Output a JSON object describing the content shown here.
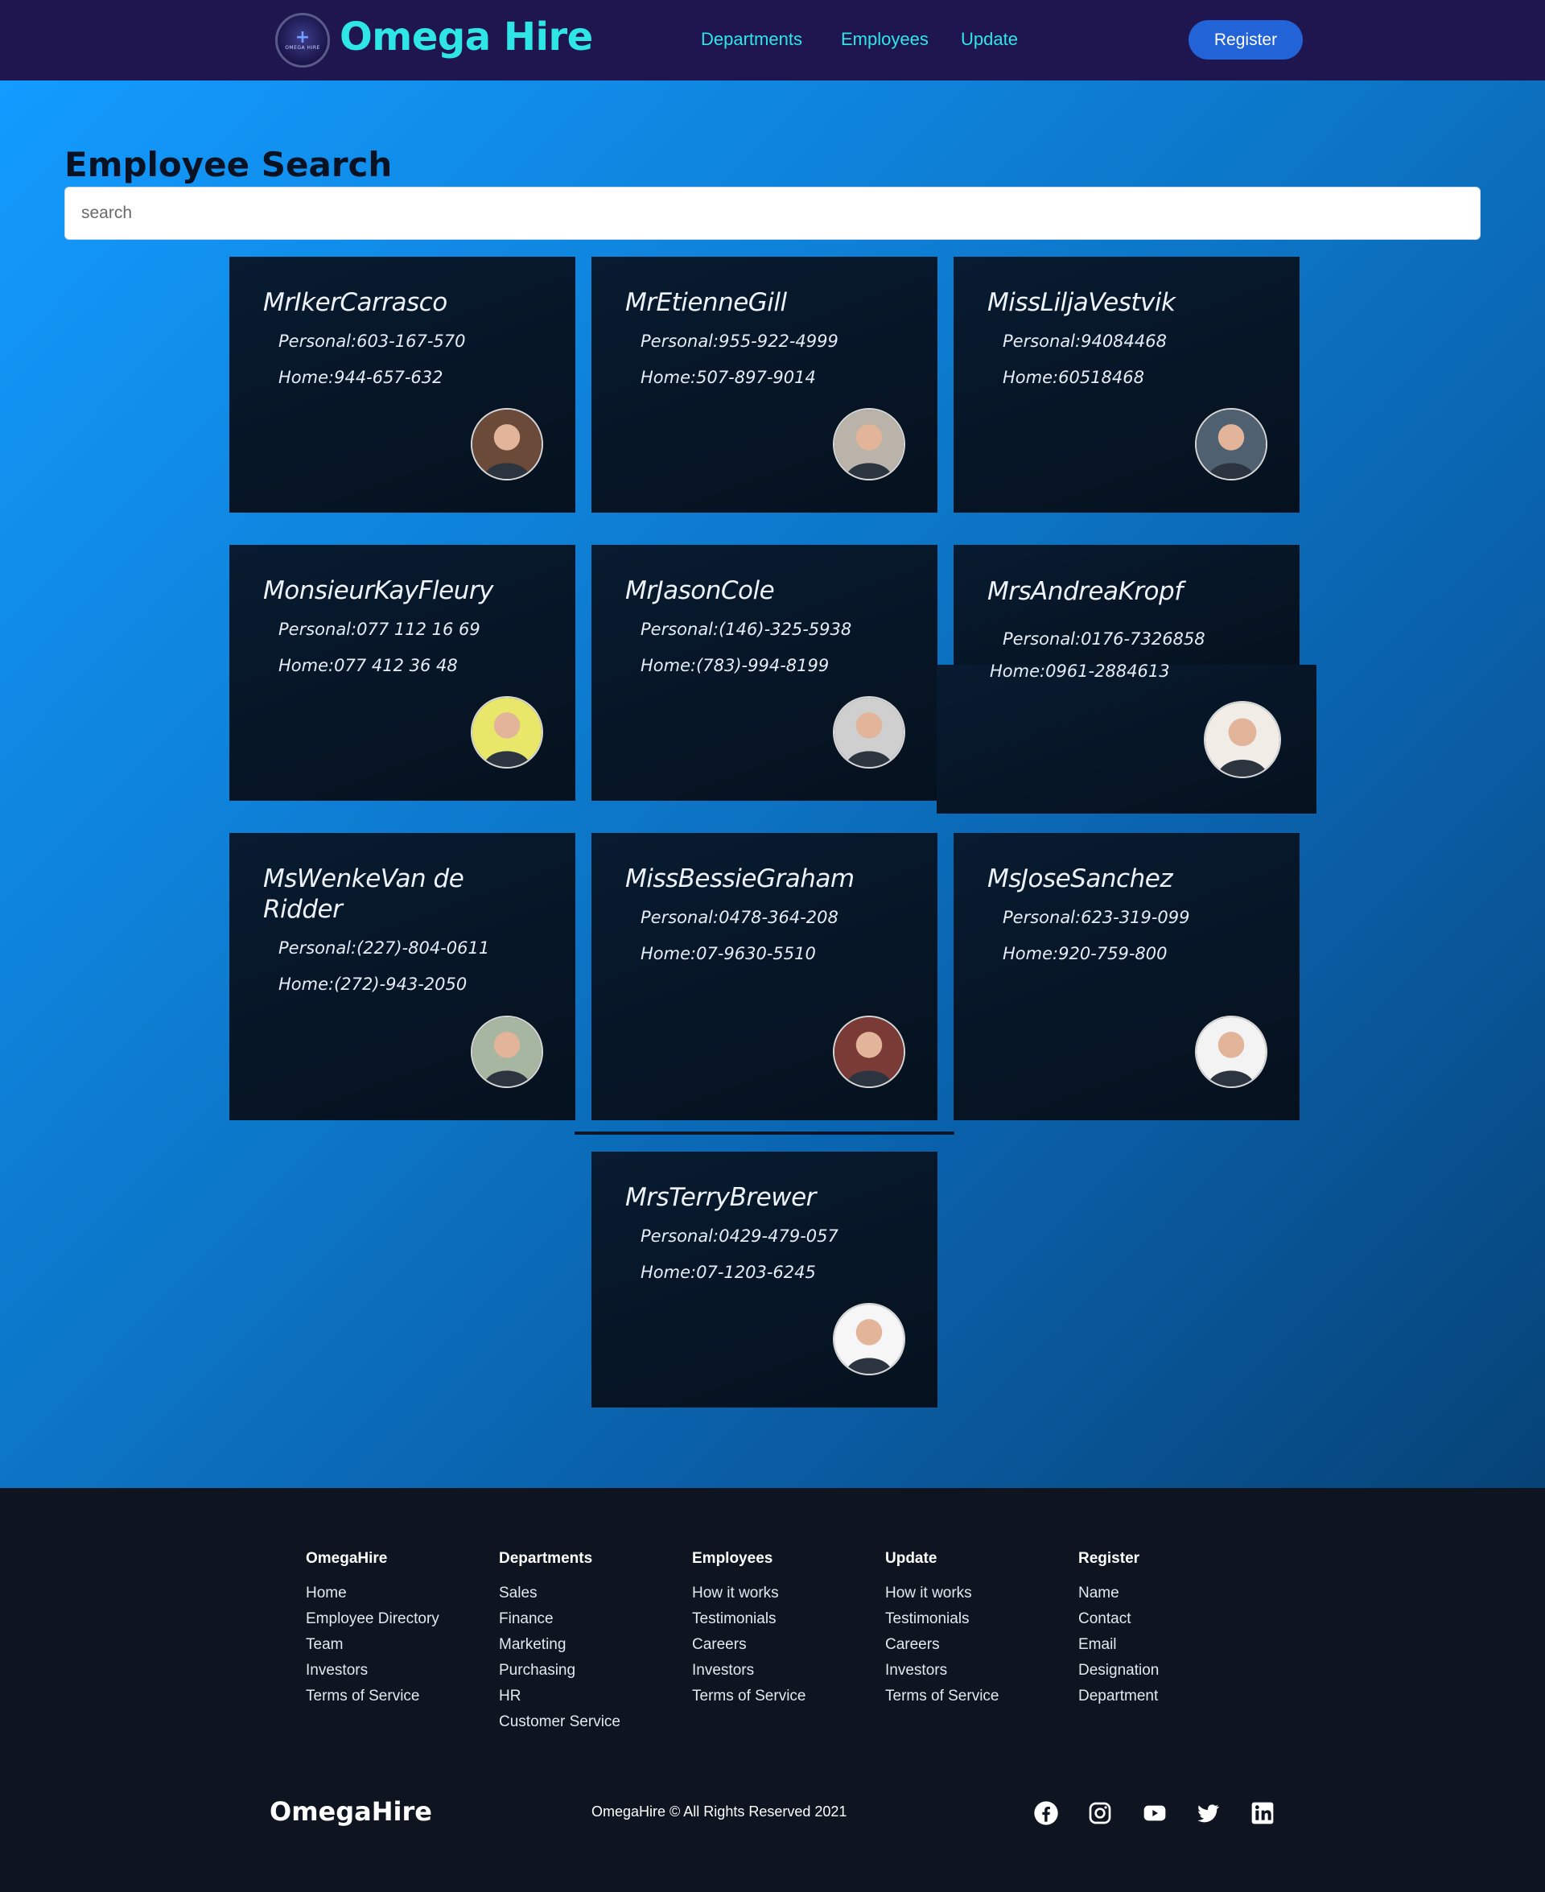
{
  "nav": {
    "logo_text": "OMEGA HIRE",
    "brand": "Omega Hire",
    "links": [
      "Departments",
      "Employees",
      "Update"
    ],
    "register": "Register"
  },
  "search": {
    "title": "Employee Search",
    "placeholder": "search"
  },
  "employees": [
    {
      "name": "MrIkerCarrasco",
      "personal": "Personal:603-167-570",
      "home": "Home:944-657-632",
      "avatar_bg": "#6b4a3a"
    },
    {
      "name": "MrEtienneGill",
      "personal": "Personal:955-922-4999",
      "home": "Home:507-897-9014",
      "avatar_bg": "#b9b3aa"
    },
    {
      "name": "MissLiljaVestvik",
      "personal": "Personal:94084468",
      "home": "Home:60518468",
      "avatar_bg": "#4f6070"
    },
    {
      "name": "MonsieurKayFleury",
      "personal": "Personal:077 112 16 69",
      "home": "Home:077 412 36 48",
      "avatar_bg": "#e8e76a"
    },
    {
      "name": "MrJasonCole",
      "personal": "Personal:(146)-325-5938",
      "home": "Home:(783)-994-8199",
      "avatar_bg": "#cfcfcf"
    },
    {
      "name": "MrsAndreaKropf",
      "personal": "Personal:0176-7326858",
      "home": "Home:0961-2884613",
      "avatar_bg": "#f2ece6"
    },
    {
      "name": "MsWenkeVan de Ridder",
      "personal": "Personal:(227)-804-0611",
      "home": "Home:(272)-943-2050",
      "avatar_bg": "#a7b6a0"
    },
    {
      "name": "MissBessieGraham",
      "personal": "Personal:0478-364-208",
      "home": "Home:07-9630-5510",
      "avatar_bg": "#7a3a36"
    },
    {
      "name": "MsJoseSanchez",
      "personal": "Personal:623-319-099",
      "home": "Home:920-759-800",
      "avatar_bg": "#f3f3f3"
    },
    {
      "name": "MrsTerryBrewer",
      "personal": "Personal:0429-479-057",
      "home": "Home:07-1203-6245",
      "avatar_bg": "#f6f6f6"
    }
  ],
  "footer": {
    "columns": [
      {
        "title": "OmegaHire",
        "links": [
          "Home",
          "Employee Directory",
          "Team",
          "Investors",
          "Terms of Service"
        ]
      },
      {
        "title": "Departments",
        "links": [
          "Sales",
          "Finance",
          "Marketing",
          "Purchasing",
          "HR",
          "Customer Service"
        ]
      },
      {
        "title": "Employees",
        "links": [
          "How it works",
          "Testimonials",
          "Careers",
          "Investors",
          "Terms of Service"
        ]
      },
      {
        "title": "Update",
        "links": [
          "How it works",
          "Testimonials",
          "Careers",
          "Investors",
          "Terms of Service"
        ]
      },
      {
        "title": "Register",
        "links": [
          "Name",
          "Contact",
          "Email",
          "Designation",
          "Department"
        ]
      }
    ],
    "brand": "OmegaHire",
    "copyright": "OmegaHire © All Rights Reserved 2021",
    "social": [
      "facebook-icon",
      "instagram-icon",
      "youtube-icon",
      "twitter-icon",
      "linkedin-icon"
    ]
  }
}
